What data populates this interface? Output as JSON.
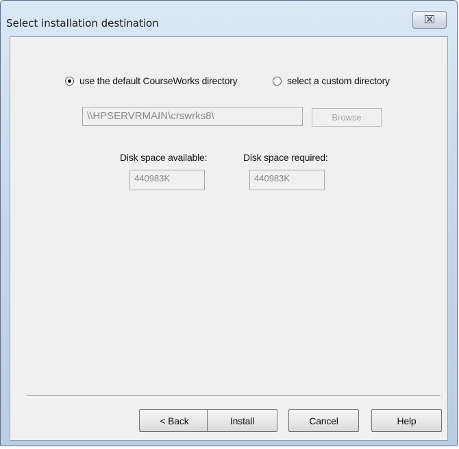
{
  "window": {
    "title": "Select installation destination",
    "close_glyph": "☒"
  },
  "destination": {
    "option_default_label": "use the default CourseWorks directory",
    "option_custom_label": "select a custom directory",
    "selected": "default",
    "path_value": "\\\\HPSERVRMAIN\\crswrks8\\",
    "browse_label": "Browse"
  },
  "disk": {
    "available_label": "Disk space available:",
    "available_value": "440983K",
    "required_label": "Disk space required:",
    "required_value": "440983K"
  },
  "buttons": {
    "back": "< Back",
    "install": "Install",
    "cancel": "Cancel",
    "help": "Help"
  }
}
